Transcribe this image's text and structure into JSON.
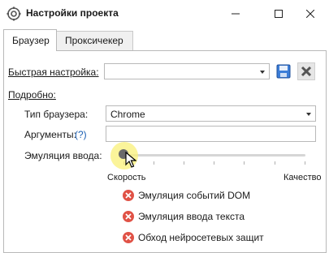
{
  "window": {
    "title": "Настройки проекта",
    "icon": "gear-icon"
  },
  "tabs": [
    {
      "label": "Браузер",
      "active": true
    },
    {
      "label": "Проксичекер",
      "active": false
    }
  ],
  "quick_settings": {
    "label": "Быстрая настройка:",
    "value": ""
  },
  "details": {
    "label": "Подробно:",
    "browser_type_label": "Тип браузера:",
    "browser_type_value": "Chrome",
    "arguments_label": "Аргументы:",
    "arguments_help": "(?)",
    "arguments_value": "",
    "input_emulation_label": "Эмуляция ввода:"
  },
  "slider": {
    "min_label": "Скорость",
    "max_label": "Качество",
    "value": 0
  },
  "features": [
    {
      "label": "Эмуляция событий DOM",
      "status": "disabled"
    },
    {
      "label": "Эмуляция ввода текста",
      "status": "disabled"
    },
    {
      "label": "Обход нейросетевых защит",
      "status": "disabled"
    }
  ],
  "colors": {
    "disabled_badge": "#e05246",
    "link_blue": "#1a5fb4",
    "save_icon_blue": "#3b7dd8"
  }
}
